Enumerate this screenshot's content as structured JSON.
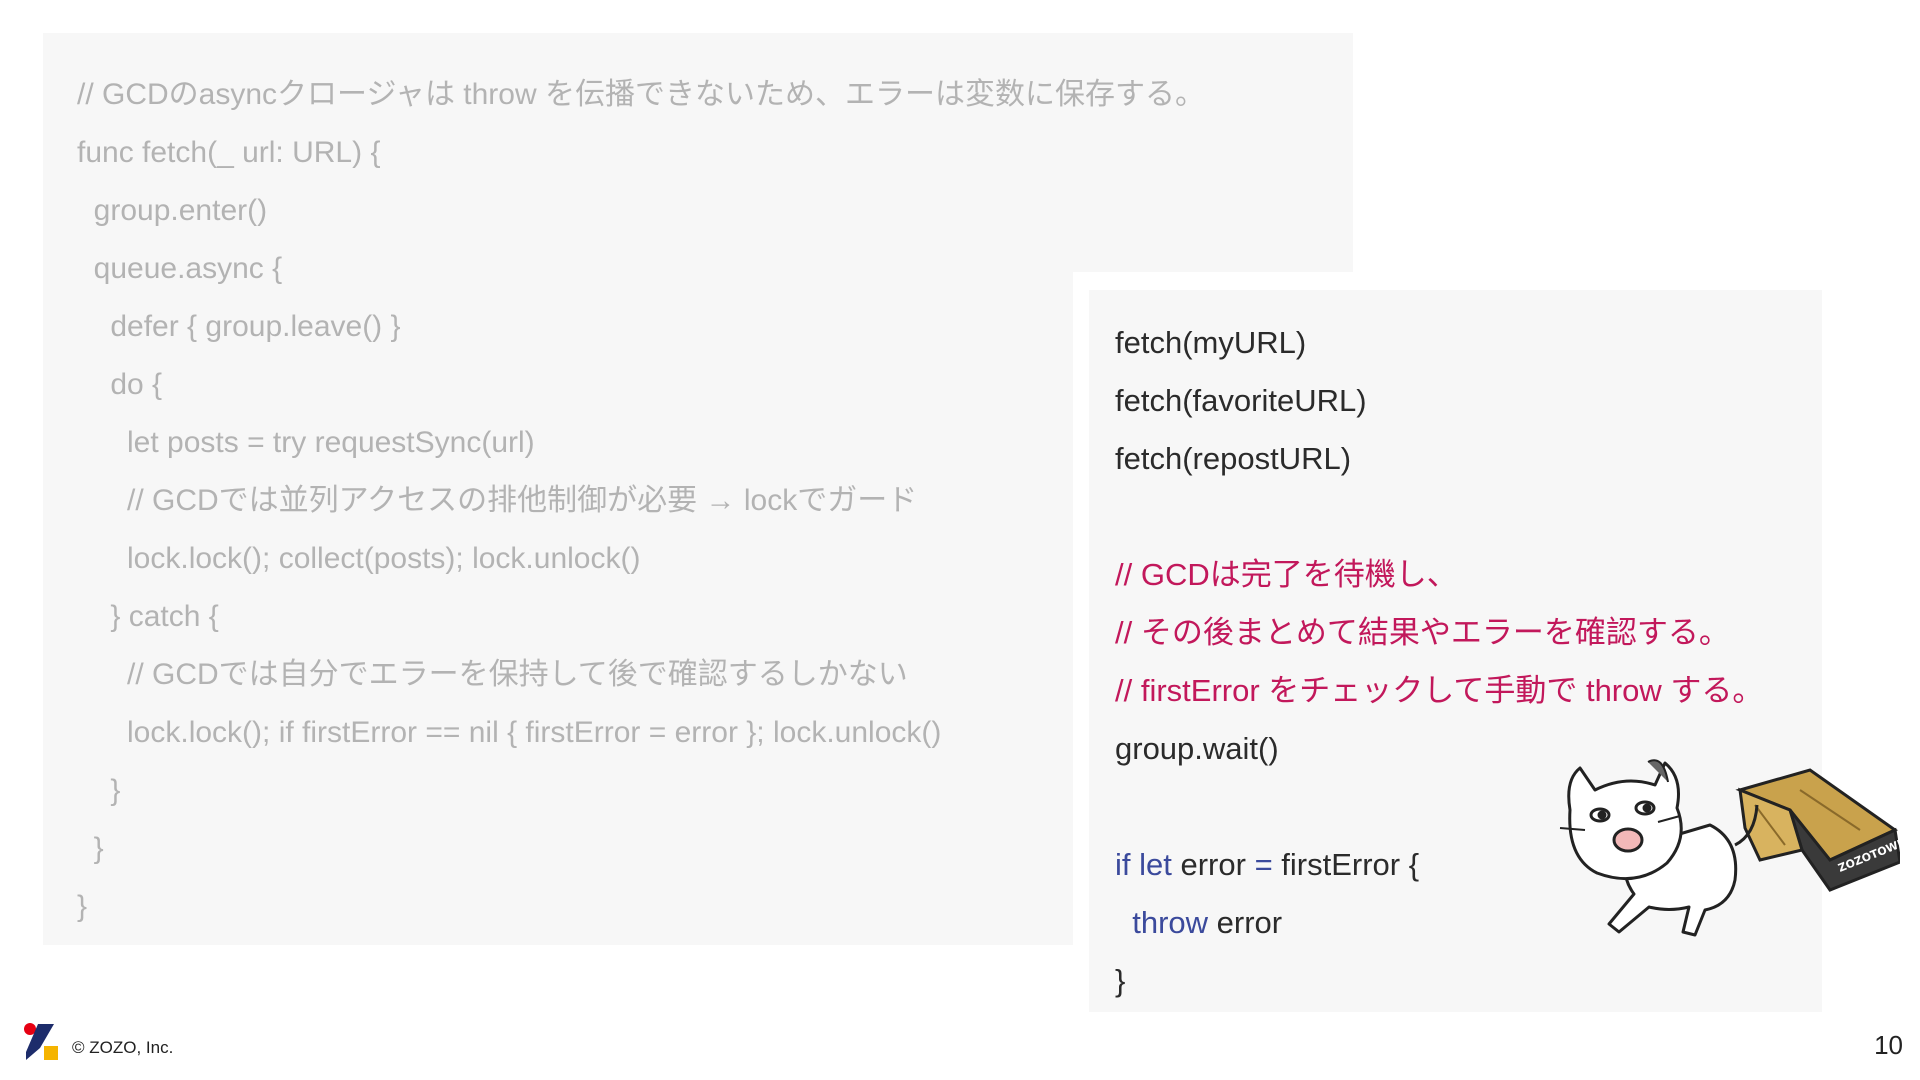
{
  "background_code": {
    "lines": [
      "// GCDのasyncクロージャは throw を伝播できないため、エラーは変数に保存する。",
      "func fetch(_ url: URL) {",
      "  group.enter()",
      "  queue.async {",
      "    defer { group.leave() }",
      "    do {",
      "      let posts = try requestSync(url)",
      "      // GCDでは並列アクセスの排他制御が必要 → lockでガード",
      "      lock.lock(); collect(posts); lock.unlock()",
      "    } catch {",
      "      // GCDでは自分でエラーを保持して後で確認するしかない",
      "      lock.lock(); if firstError == nil { firstError = error }; lock.unlock()",
      "    }",
      "  }",
      "}"
    ]
  },
  "foreground_code": {
    "line1": "fetch(myURL)",
    "line2": "fetch(favoriteURL)",
    "line3": "fetch(repostURL)",
    "comment1": "// GCDは完了を待機し、",
    "comment2": "// その後まとめて結果やエラーを確認する。",
    "comment3": "// firstError をチェックして手動で throw する。",
    "line4": "group.wait()",
    "if_kw": "if",
    "let_kw": "let",
    "if_rest_1": " error ",
    "eq": "=",
    "if_rest_2": " firstError {",
    "indent": "  ",
    "throw_kw": "throw",
    "throw_rest": " error",
    "close": "}"
  },
  "illustration": {
    "box_label": "ZOZOTOWN"
  },
  "footer": {
    "copyright": "© ZOZO, Inc.",
    "page_number": "10"
  },
  "colors": {
    "panel_background": "#f7f7f7",
    "faded_code": "#b3b3b3",
    "code_text": "#2b2b2b",
    "comment": "#c2185b",
    "keyword": "#3b4a9c",
    "logo_red": "#e60012",
    "logo_blue": "#1d2c6b",
    "logo_yellow": "#f5b400"
  }
}
